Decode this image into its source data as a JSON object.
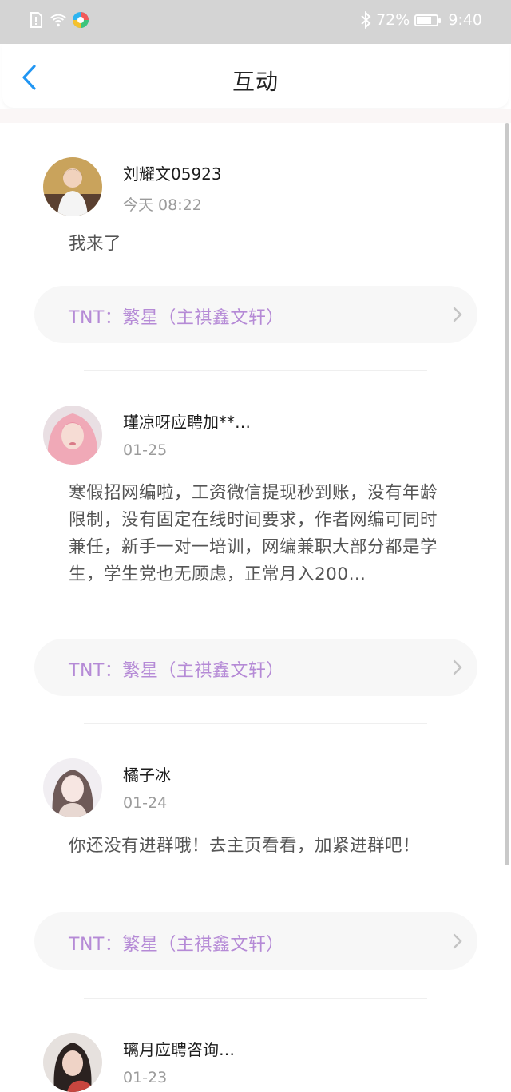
{
  "status_bar": {
    "battery": "72%",
    "battery_level": 0.72,
    "time": "9:40",
    "icons": [
      "sim-alert-icon",
      "wifi-icon",
      "app-notification-icon",
      "bluetooth-icon",
      "battery-icon"
    ]
  },
  "header": {
    "title": "互动",
    "back_icon": "chevron-left-icon"
  },
  "colors": {
    "accent_blue": "#2196f3",
    "topic_purple": "#b58ad6",
    "status_bar": "#d4d4d4",
    "time_gray": "#9b9b9b"
  },
  "posts": [
    {
      "username": "刘耀文05923",
      "time": "今天 08:22",
      "content": "我来了",
      "topic": "TNT：繁星（主祺鑫文轩）"
    },
    {
      "username": "瑾凉呀应聘加**…",
      "time": "01-25",
      "content": "寒假招网编啦，工资微信提现秒到账，没有年龄限制，没有固定在线时间要求，作者网编可同时兼任，新手一对一培训，网编兼职大部分都是学生，学生党也无顾虑，正常月入200…",
      "topic": "TNT：繁星（主祺鑫文轩）"
    },
    {
      "username": "橘子冰",
      "time": "01-24",
      "content": "你还没有进群哦！去主页看看，加紧进群吧！",
      "topic": "TNT：繁星（主祺鑫文轩）"
    },
    {
      "username": "璃月应聘咨询…",
      "time": "01-23"
    }
  ]
}
